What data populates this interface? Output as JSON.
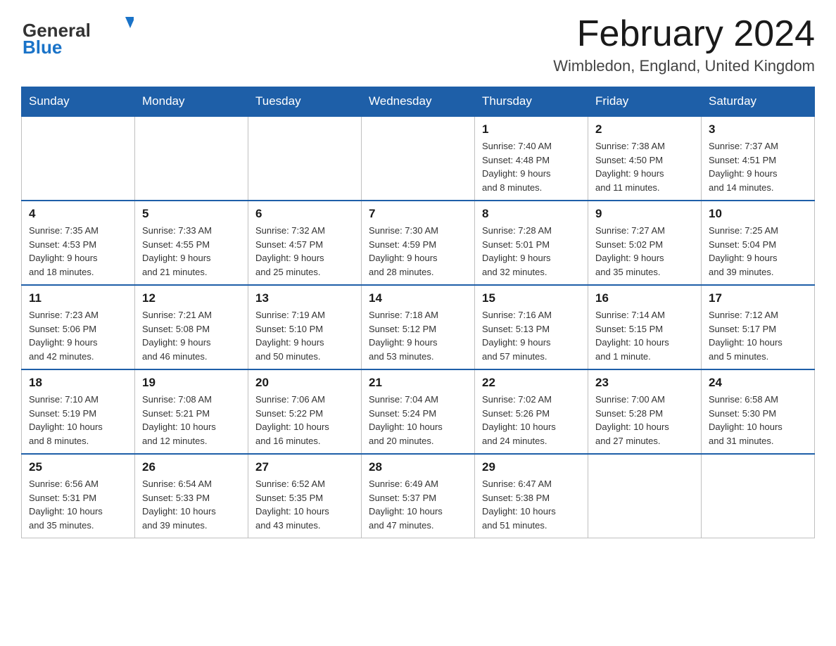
{
  "header": {
    "logo_line1": "General",
    "logo_line2": "Blue",
    "month_title": "February 2024",
    "location": "Wimbledon, England, United Kingdom"
  },
  "days_of_week": [
    "Sunday",
    "Monday",
    "Tuesday",
    "Wednesday",
    "Thursday",
    "Friday",
    "Saturday"
  ],
  "weeks": [
    [
      {
        "day": "",
        "info": ""
      },
      {
        "day": "",
        "info": ""
      },
      {
        "day": "",
        "info": ""
      },
      {
        "day": "",
        "info": ""
      },
      {
        "day": "1",
        "info": "Sunrise: 7:40 AM\nSunset: 4:48 PM\nDaylight: 9 hours\nand 8 minutes."
      },
      {
        "day": "2",
        "info": "Sunrise: 7:38 AM\nSunset: 4:50 PM\nDaylight: 9 hours\nand 11 minutes."
      },
      {
        "day": "3",
        "info": "Sunrise: 7:37 AM\nSunset: 4:51 PM\nDaylight: 9 hours\nand 14 minutes."
      }
    ],
    [
      {
        "day": "4",
        "info": "Sunrise: 7:35 AM\nSunset: 4:53 PM\nDaylight: 9 hours\nand 18 minutes."
      },
      {
        "day": "5",
        "info": "Sunrise: 7:33 AM\nSunset: 4:55 PM\nDaylight: 9 hours\nand 21 minutes."
      },
      {
        "day": "6",
        "info": "Sunrise: 7:32 AM\nSunset: 4:57 PM\nDaylight: 9 hours\nand 25 minutes."
      },
      {
        "day": "7",
        "info": "Sunrise: 7:30 AM\nSunset: 4:59 PM\nDaylight: 9 hours\nand 28 minutes."
      },
      {
        "day": "8",
        "info": "Sunrise: 7:28 AM\nSunset: 5:01 PM\nDaylight: 9 hours\nand 32 minutes."
      },
      {
        "day": "9",
        "info": "Sunrise: 7:27 AM\nSunset: 5:02 PM\nDaylight: 9 hours\nand 35 minutes."
      },
      {
        "day": "10",
        "info": "Sunrise: 7:25 AM\nSunset: 5:04 PM\nDaylight: 9 hours\nand 39 minutes."
      }
    ],
    [
      {
        "day": "11",
        "info": "Sunrise: 7:23 AM\nSunset: 5:06 PM\nDaylight: 9 hours\nand 42 minutes."
      },
      {
        "day": "12",
        "info": "Sunrise: 7:21 AM\nSunset: 5:08 PM\nDaylight: 9 hours\nand 46 minutes."
      },
      {
        "day": "13",
        "info": "Sunrise: 7:19 AM\nSunset: 5:10 PM\nDaylight: 9 hours\nand 50 minutes."
      },
      {
        "day": "14",
        "info": "Sunrise: 7:18 AM\nSunset: 5:12 PM\nDaylight: 9 hours\nand 53 minutes."
      },
      {
        "day": "15",
        "info": "Sunrise: 7:16 AM\nSunset: 5:13 PM\nDaylight: 9 hours\nand 57 minutes."
      },
      {
        "day": "16",
        "info": "Sunrise: 7:14 AM\nSunset: 5:15 PM\nDaylight: 10 hours\nand 1 minute."
      },
      {
        "day": "17",
        "info": "Sunrise: 7:12 AM\nSunset: 5:17 PM\nDaylight: 10 hours\nand 5 minutes."
      }
    ],
    [
      {
        "day": "18",
        "info": "Sunrise: 7:10 AM\nSunset: 5:19 PM\nDaylight: 10 hours\nand 8 minutes."
      },
      {
        "day": "19",
        "info": "Sunrise: 7:08 AM\nSunset: 5:21 PM\nDaylight: 10 hours\nand 12 minutes."
      },
      {
        "day": "20",
        "info": "Sunrise: 7:06 AM\nSunset: 5:22 PM\nDaylight: 10 hours\nand 16 minutes."
      },
      {
        "day": "21",
        "info": "Sunrise: 7:04 AM\nSunset: 5:24 PM\nDaylight: 10 hours\nand 20 minutes."
      },
      {
        "day": "22",
        "info": "Sunrise: 7:02 AM\nSunset: 5:26 PM\nDaylight: 10 hours\nand 24 minutes."
      },
      {
        "day": "23",
        "info": "Sunrise: 7:00 AM\nSunset: 5:28 PM\nDaylight: 10 hours\nand 27 minutes."
      },
      {
        "day": "24",
        "info": "Sunrise: 6:58 AM\nSunset: 5:30 PM\nDaylight: 10 hours\nand 31 minutes."
      }
    ],
    [
      {
        "day": "25",
        "info": "Sunrise: 6:56 AM\nSunset: 5:31 PM\nDaylight: 10 hours\nand 35 minutes."
      },
      {
        "day": "26",
        "info": "Sunrise: 6:54 AM\nSunset: 5:33 PM\nDaylight: 10 hours\nand 39 minutes."
      },
      {
        "day": "27",
        "info": "Sunrise: 6:52 AM\nSunset: 5:35 PM\nDaylight: 10 hours\nand 43 minutes."
      },
      {
        "day": "28",
        "info": "Sunrise: 6:49 AM\nSunset: 5:37 PM\nDaylight: 10 hours\nand 47 minutes."
      },
      {
        "day": "29",
        "info": "Sunrise: 6:47 AM\nSunset: 5:38 PM\nDaylight: 10 hours\nand 51 minutes."
      },
      {
        "day": "",
        "info": ""
      },
      {
        "day": "",
        "info": ""
      }
    ]
  ]
}
